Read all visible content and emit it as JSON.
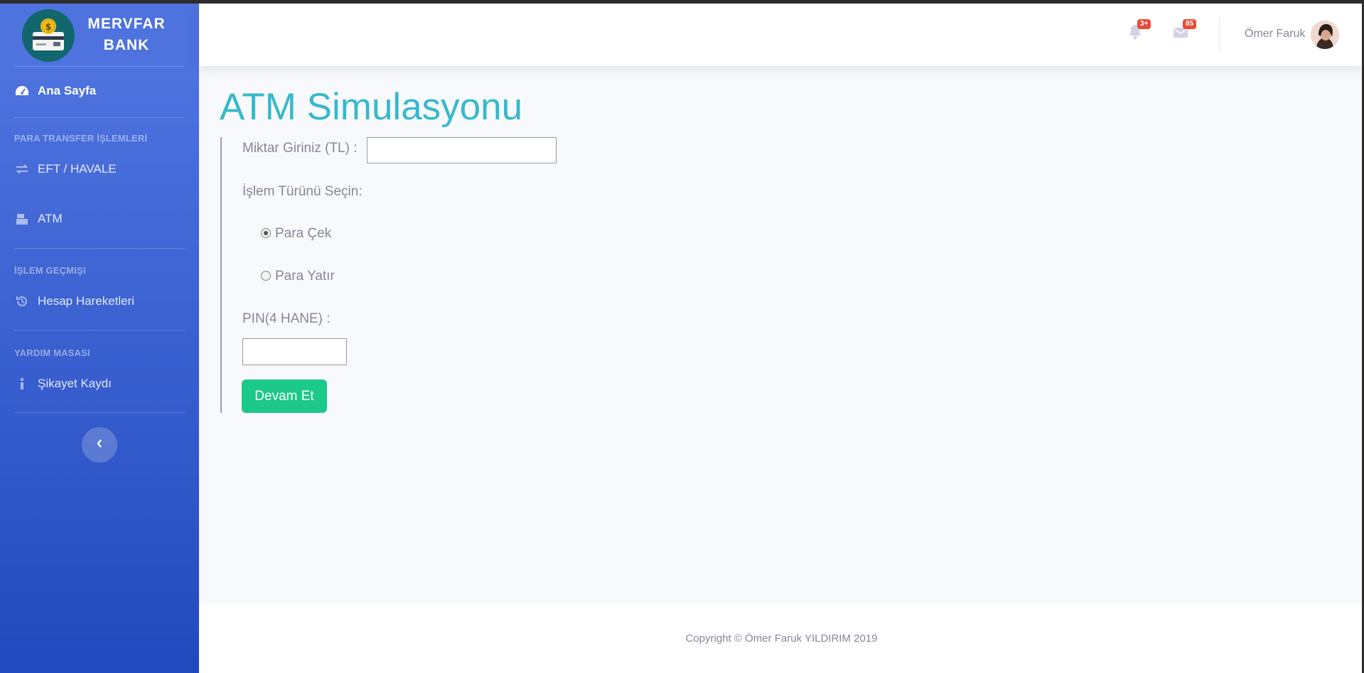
{
  "brand": {
    "name": "MERVFAR BANK"
  },
  "sidebar": {
    "home": {
      "label": "Ana Sayfa",
      "icon": "tachometer-icon"
    },
    "sections": [
      {
        "heading": "PARA TRANSFER İŞLEMLERİ",
        "items": [
          {
            "label": "EFT / HAVALE",
            "icon": "exchange-icon"
          },
          {
            "label": "ATM",
            "icon": "atm-icon"
          }
        ]
      },
      {
        "heading": "İŞLEM GEÇMIŞI",
        "items": [
          {
            "label": "Hesap Hareketleri",
            "icon": "history-icon"
          }
        ]
      },
      {
        "heading": "YARDIM MASASI",
        "items": [
          {
            "label": "Şikayet Kaydı",
            "icon": "info-icon"
          }
        ]
      }
    ],
    "toggle_icon": "chevron-left-icon"
  },
  "topbar": {
    "alerts_badge": "3+",
    "messages_badge": "85",
    "user_name": "Ömer Faruk"
  },
  "main": {
    "title": "ATM Simulasyonu",
    "amount_label": "Miktar Giriniz (TL) :",
    "amount_value": "",
    "type_label": "İşlem Türünü Seçin:",
    "options": [
      {
        "label": "Para Çek",
        "checked": true
      },
      {
        "label": "Para Yatır",
        "checked": false
      }
    ],
    "pin_label": "PIN(4 HANE) :",
    "pin_value": "",
    "submit_label": "Devam Et"
  },
  "footer": {
    "copyright": "Copyright © Ömer Faruk YILDIRIM 2019"
  },
  "colors": {
    "sidebar_top": "#4e73df",
    "sidebar_bottom": "#224abe",
    "title": "#36b9cc",
    "button": "#1cc88a",
    "badge": "#e74a3b"
  }
}
